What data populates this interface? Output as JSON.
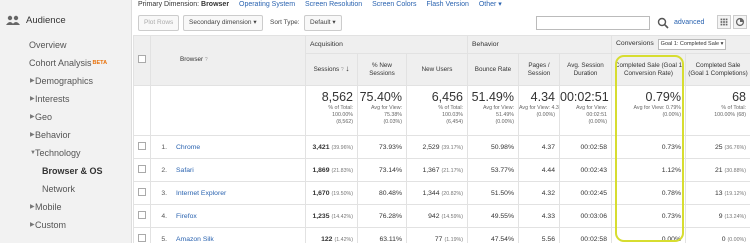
{
  "sidebar": {
    "section_title": "Audience",
    "items": [
      {
        "label": "Overview"
      },
      {
        "label": "Cohort Analysis",
        "badge": "BETA"
      },
      {
        "label": "Demographics"
      },
      {
        "label": "Interests"
      },
      {
        "label": "Geo"
      },
      {
        "label": "Behavior"
      },
      {
        "label": "Technology"
      },
      {
        "label": "Browser & OS"
      },
      {
        "label": "Network"
      },
      {
        "label": "Mobile"
      },
      {
        "label": "Custom"
      }
    ]
  },
  "dimensions": {
    "label": "Primary Dimension:",
    "current": "Browser",
    "links": [
      "Operating System",
      "Screen Resolution",
      "Screen Colors",
      "Flash Version",
      "Other ▾"
    ]
  },
  "toolbar": {
    "plot_rows": "Plot Rows",
    "secondary_dimension": "Secondary dimension ▾",
    "sort_type_label": "Sort Type:",
    "sort_type_value": "Default ▾",
    "search_value": "",
    "advanced": "advanced"
  },
  "table": {
    "groups": {
      "acquisition": "Acquisition",
      "behavior": "Behavior",
      "conversions": "Conversions",
      "goal_select": "Goal 1: Completed Sale ▾"
    },
    "headers": {
      "browser": "Browser",
      "sessions": "Sessions",
      "new_sessions": "% New Sessions",
      "new_users": "New Users",
      "bounce_rate": "Bounce Rate",
      "pages_session": "Pages / Session",
      "avg_duration": "Avg. Session Duration",
      "conv_rate": "Completed Sale (Goal 1 Conversion Rate)",
      "completions": "Completed Sale (Goal 1 Completions)"
    },
    "totals": {
      "sessions": {
        "big": "8,562",
        "sub": [
          "% of Total:",
          "100.00%",
          "(8,562)"
        ]
      },
      "new_sessions": {
        "big": "75.40%",
        "sub": [
          "Avg for View:",
          "75.38%",
          "(0.03%)"
        ]
      },
      "new_users": {
        "big": "6,456",
        "sub": [
          "% of Total:",
          "100.03%",
          "(6,454)"
        ]
      },
      "bounce_rate": {
        "big": "51.49%",
        "sub": [
          "Avg for View:",
          "51.49%",
          "(0.00%)"
        ]
      },
      "pages_session": {
        "big": "4.34",
        "sub": [
          "Avg for View: 4.34",
          "(0.00%)"
        ]
      },
      "avg_duration": {
        "big": "00:02:51",
        "sub": [
          "Avg for View:",
          "00:02:51",
          "(0.00%)"
        ]
      },
      "conv_rate": {
        "big": "0.79%",
        "sub": [
          "Avg for View: 0.79%",
          "(0.00%)"
        ]
      },
      "completions": {
        "big": "68",
        "sub": [
          "% of Total:",
          "100.00% (68)"
        ]
      }
    },
    "rows": [
      {
        "n": "1.",
        "browser": "Chrome",
        "sessions": "3,421",
        "sessions_pct": "(39.96%)",
        "new_sessions": "73.93%",
        "new_users": "2,529",
        "new_users_pct": "(39.17%)",
        "bounce": "50.98%",
        "pages": "4.37",
        "duration": "00:02:58",
        "conv": "0.73%",
        "comp": "25",
        "comp_pct": "(36.76%)"
      },
      {
        "n": "2.",
        "browser": "Safari",
        "sessions": "1,869",
        "sessions_pct": "(21.83%)",
        "new_sessions": "73.14%",
        "new_users": "1,367",
        "new_users_pct": "(21.17%)",
        "bounce": "53.77%",
        "pages": "4.44",
        "duration": "00:02:43",
        "conv": "1.12%",
        "comp": "21",
        "comp_pct": "(30.88%)"
      },
      {
        "n": "3.",
        "browser": "Internet Explorer",
        "sessions": "1,670",
        "sessions_pct": "(19.50%)",
        "new_sessions": "80.48%",
        "new_users": "1,344",
        "new_users_pct": "(20.82%)",
        "bounce": "51.50%",
        "pages": "4.32",
        "duration": "00:02:45",
        "conv": "0.78%",
        "comp": "13",
        "comp_pct": "(19.12%)"
      },
      {
        "n": "4.",
        "browser": "Firefox",
        "sessions": "1,235",
        "sessions_pct": "(14.42%)",
        "new_sessions": "76.28%",
        "new_users": "942",
        "new_users_pct": "(14.59%)",
        "bounce": "49.55%",
        "pages": "4.33",
        "duration": "00:03:06",
        "conv": "0.73%",
        "comp": "9",
        "comp_pct": "(13.24%)"
      },
      {
        "n": "5.",
        "browser": "Amazon Silk",
        "sessions": "122",
        "sessions_pct": "(1.42%)",
        "new_sessions": "63.11%",
        "new_users": "77",
        "new_users_pct": "(1.19%)",
        "bounce": "47.54%",
        "pages": "5.56",
        "duration": "00:02:58",
        "conv": "0.00%",
        "comp": "0",
        "comp_pct": "(0.00%)"
      }
    ]
  },
  "colors": {
    "link": "#2a63b0",
    "highlight": "#d7dd30",
    "beta": "#e8710a"
  }
}
